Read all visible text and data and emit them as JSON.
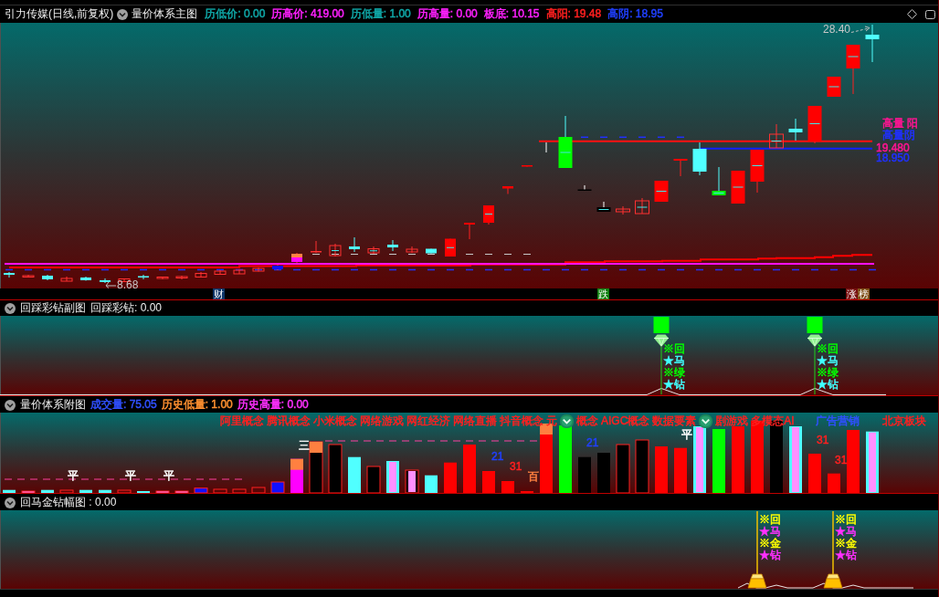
{
  "title_bar": {
    "stock": "引力传媒(日线,前复权)",
    "indicator": "量价体系主图",
    "readings": [
      {
        "text": "历低价: 0.00",
        "color": "#10a8a8"
      },
      {
        "text": "历高价: 419.00",
        "color": "#ff20ff"
      },
      {
        "text": "历低量: 1.00",
        "color": "#10a8a8"
      },
      {
        "text": "历高量: 0.00",
        "color": "#ff20ff"
      },
      {
        "text": "板底: 10.15",
        "color": "#ff20ff"
      },
      {
        "text": "高阳: 19.48",
        "color": "#ff2020"
      },
      {
        "text": "高阴: 18.95",
        "color": "#2040ff"
      }
    ]
  },
  "main_chart": {
    "price_labels": [
      {
        "kind": "high",
        "text": "28.40"
      },
      {
        "kind": "low",
        "text": "8.68"
      }
    ],
    "level_labels": [
      {
        "text": "高量 阳",
        "color": "#ff1493"
      },
      {
        "text": "高量阴",
        "color": "#2030ff"
      },
      {
        "text": "19.480",
        "color": "#ff1493"
      },
      {
        "text": "18.950",
        "color": "#2030ff"
      }
    ],
    "event_tags": [
      {
        "text": "财",
        "color": "#0c3468"
      },
      {
        "text": "跌",
        "color": "#108010"
      },
      {
        "text": "涨",
        "color": "#781010"
      },
      {
        "text": "榜",
        "color": "#805018"
      }
    ]
  },
  "sub_chart_1": {
    "indicator": "回踩彩钻副图",
    "reading": "回踩彩钻: 0.00",
    "signals": [
      {
        "labels": [
          {
            "text": "※回",
            "color": "#00ff00"
          },
          {
            "text": "★马",
            "color": "#40ffff"
          },
          {
            "text": "※绿",
            "color": "#00ff00"
          },
          {
            "text": "★钻",
            "color": "#40ffff"
          }
        ]
      },
      {
        "labels": [
          {
            "text": "※回",
            "color": "#00ff00"
          },
          {
            "text": "★马",
            "color": "#40ffff"
          },
          {
            "text": "※绿",
            "color": "#00ff00"
          },
          {
            "text": "★钻",
            "color": "#40ffff"
          }
        ]
      }
    ]
  },
  "sub_chart_2": {
    "indicator": "量价体系附图",
    "readings": [
      {
        "text": "成交量: 75.05",
        "color": "#3050ff"
      },
      {
        "text": "历史低量: 1.00",
        "color": "#ff9030"
      },
      {
        "text": "历史高量: 0.00",
        "color": "#ff30ff"
      }
    ],
    "concepts": [
      {
        "text": "阿里概念",
        "color": "#ff2020"
      },
      {
        "text": "腾讯概念",
        "color": "#ff2020"
      },
      {
        "text": "小米概念",
        "color": "#ff2020"
      },
      {
        "text": "网络游戏",
        "color": "#ff2020"
      },
      {
        "text": "网红经济",
        "color": "#ff2020"
      },
      {
        "text": "网络直播",
        "color": "#ff2020"
      },
      {
        "text": "抖音概念",
        "color": "#ff2020"
      },
      {
        "text": "元",
        "color": "#ff2020"
      },
      {
        "text": "概念",
        "color": "#ff2020"
      },
      {
        "text": "AIGC概念",
        "color": "#ff2020"
      },
      {
        "text": "数据要素",
        "color": "#ff2020"
      },
      {
        "text": "剧游戏",
        "color": "#ff2020"
      },
      {
        "text": "多模态AI",
        "color": "#ff2020"
      },
      {
        "text": "广告营销",
        "color": "#3050ff"
      },
      {
        "text": "北京板块",
        "color": "#ff2020"
      }
    ],
    "bar_marks": [
      {
        "text": "平",
        "color": "#ffffff"
      },
      {
        "text": "平",
        "color": "#ffffff"
      },
      {
        "text": "平",
        "color": "#ffffff"
      },
      {
        "text": "三",
        "color": "#ffffff"
      },
      {
        "text": "21",
        "color": "#2040ff"
      },
      {
        "text": "31",
        "color": "#ff2020"
      },
      {
        "text": "百",
        "color": "#ff8040"
      },
      {
        "text": "21",
        "color": "#2040ff"
      },
      {
        "text": "平",
        "color": "#ffffff"
      },
      {
        "text": "31",
        "color": "#ff2020"
      },
      {
        "text": "31",
        "color": "#ff2020"
      }
    ]
  },
  "sub_chart_3": {
    "title": "回马金钻幅图 : 0.00",
    "signals": [
      {
        "labels": [
          {
            "text": "※回",
            "color": "#ffff00"
          },
          {
            "text": "★马",
            "color": "#ff30ff"
          },
          {
            "text": "※金",
            "color": "#ffff00"
          },
          {
            "text": "★钻",
            "color": "#ff30ff"
          }
        ]
      },
      {
        "labels": [
          {
            "text": "※回",
            "color": "#ffff00"
          },
          {
            "text": "★马",
            "color": "#ff30ff"
          },
          {
            "text": "※金",
            "color": "#ffff00"
          },
          {
            "text": "★钻",
            "color": "#ff30ff"
          }
        ]
      }
    ]
  }
}
